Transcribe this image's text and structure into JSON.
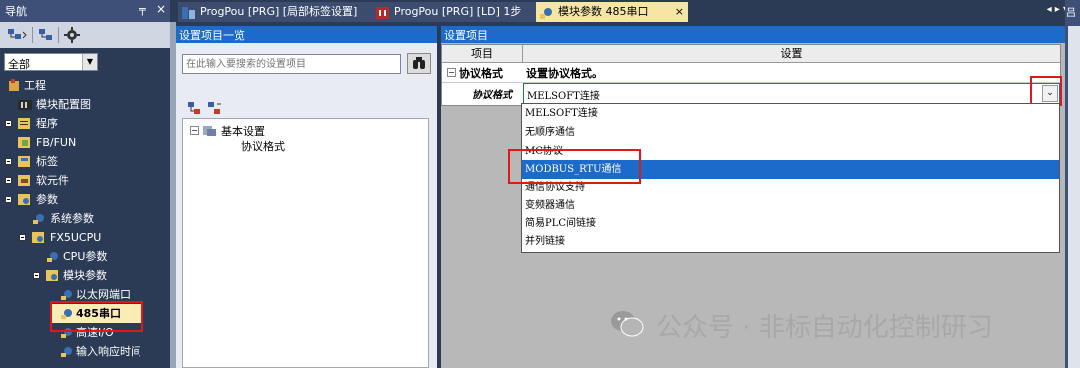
{
  "nav": {
    "title": "导航",
    "pin_glyph": "╤",
    "close_glyph": "×",
    "filter_value": "全部",
    "items": [
      {
        "label": "工程"
      },
      {
        "label": "模块配置图"
      },
      {
        "label": "程序"
      },
      {
        "label": "FB/FUN"
      },
      {
        "label": "标签"
      },
      {
        "label": "软元件"
      },
      {
        "label": "参数"
      },
      {
        "label": "系统参数"
      },
      {
        "label": "FX5UCPU"
      },
      {
        "label": "CPU参数"
      },
      {
        "label": "模块参数"
      },
      {
        "label": "以太网端口"
      },
      {
        "label": "485串口"
      },
      {
        "label": "高速I/O"
      },
      {
        "label": "输入响应时间"
      }
    ]
  },
  "tabs": [
    {
      "label": "ProgPou [PRG] [局部标签设置]"
    },
    {
      "label": "ProgPou [PRG] [LD] 1步"
    },
    {
      "label": "模块参数 485串口"
    }
  ],
  "tab_scroll": "◂ ▸ ▾",
  "settings_list": {
    "title": "设置项目一览",
    "search_placeholder": "在此输入要搜索的设置项目",
    "tree_root": "基本设置",
    "tree_child": "协议格式"
  },
  "settings": {
    "title": "设置项目",
    "col_item": "项目",
    "col_setting": "设置",
    "group_label": "协议格式",
    "group_value": "设置协议格式。",
    "row_label": "协议格式",
    "row_value": "MELSOFT连接",
    "options": [
      "MELSOFT连接",
      "无顺序通信",
      "MC协议",
      "MODBUS_RTU通信",
      "通信协议支持",
      "变频器通信",
      "简易PLC间链接",
      "并列链接"
    ]
  },
  "watermark": "公众号 · 非标自动化控制研习",
  "right_edge_glyph": "吕",
  "colors": {
    "highlight": "#1c6ac9",
    "annotation": "#e01818",
    "panel_bg": "#b8b8b8"
  }
}
